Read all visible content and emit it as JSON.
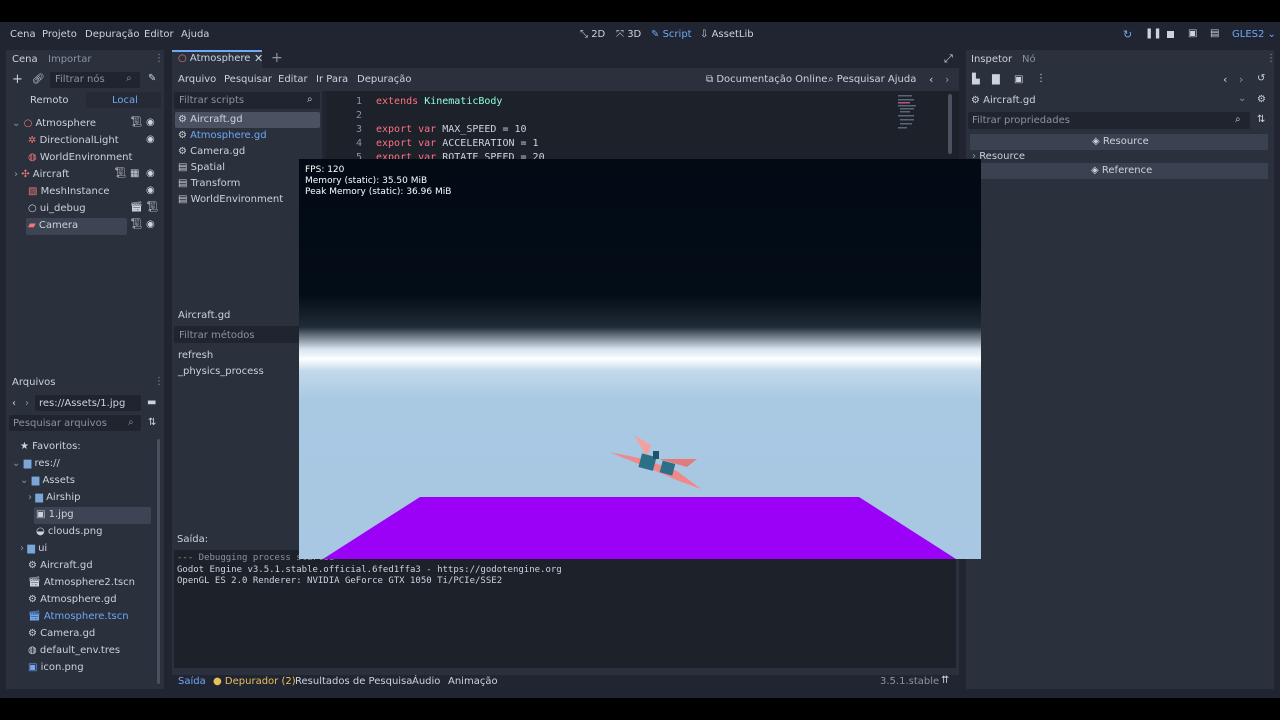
{
  "menu": [
    "Cena",
    "Projeto",
    "Depuração",
    "Editor",
    "Ajuda"
  ],
  "workspaces": [
    {
      "icon": "2d-icon",
      "label": "2D"
    },
    {
      "icon": "3d-icon",
      "label": "3D"
    },
    {
      "icon": "script-icon",
      "label": "Script"
    },
    {
      "icon": "assetlib-icon",
      "label": "AssetLib"
    }
  ],
  "renderer": "GLES2",
  "scene_dock": {
    "tabs": [
      "Cena",
      "Importar"
    ],
    "filter_placeholder": "Filtrar nós",
    "remote": "Remoto",
    "local": "Local",
    "nodes": [
      "Atmosphere",
      "DirectionalLight",
      "WorldEnvironment",
      "Aircraft",
      "MeshInstance",
      "ui_debug",
      "Camera"
    ]
  },
  "files_dock": {
    "title": "Arquivos",
    "path": "res://Assets/1.jpg",
    "search_placeholder": "Pesquisar arquivos",
    "favorites": "Favoritos:",
    "items": [
      "res://",
      "Assets",
      "Airship",
      "1.jpg",
      "clouds.png",
      "ui",
      "Aircraft.gd",
      "Atmosphere2.tscn",
      "Atmosphere.gd",
      "Atmosphere.tscn",
      "Camera.gd",
      "default_env.tres",
      "icon.png"
    ]
  },
  "editor_tabs": {
    "active": "Atmosphere"
  },
  "script_menu": [
    "Arquivo",
    "Pesquisar",
    "Editar",
    "Ir Para",
    "Depuração"
  ],
  "docs_link": "Documentação Online",
  "search_help": "Pesquisar Ajuda",
  "scripts": {
    "filter_placeholder": "Filtrar scripts",
    "items": [
      "Aircraft.gd",
      "Atmosphere.gd",
      "Camera.gd",
      "Spatial",
      "Transform",
      "WorldEnvironment"
    ],
    "current": "Aircraft.gd",
    "methods_placeholder": "Filtrar métodos",
    "methods": [
      "refresh",
      "_physics_process"
    ]
  },
  "code": [
    {
      "n": "1",
      "kw": "extends",
      "rest": "KinematicBody"
    },
    {
      "n": "2",
      "kw": "",
      "rest": ""
    },
    {
      "n": "3",
      "kw": "export var",
      "rest": "MAX_SPEED = 10"
    },
    {
      "n": "4",
      "kw": "export var",
      "rest": "ACCELERATION = 1"
    },
    {
      "n": "5",
      "kw": "export var",
      "rest": "ROTATE_SPEED = 20"
    }
  ],
  "game": {
    "fps": "FPS: 120",
    "memory": "Memory (static): 35.50 MiB",
    "peak": "Peak Memory (static): 36.96 MiB"
  },
  "output": {
    "title": "Saída:",
    "lines": [
      "--- Debugging process started ---",
      "Godot Engine v3.5.1.stable.official.6fed1ffa3 - https://godotengine.org",
      "OpenGL ES 2.0 Renderer: NVIDIA GeForce GTX 1050 Ti/PCIe/SSE2"
    ]
  },
  "bottom_tabs": [
    "Saída",
    "Depurador (2)",
    "Resultados de Pesquisa",
    "Áudio",
    "Animação"
  ],
  "version": "3.5.1.stable",
  "inspector": {
    "tabs": [
      "Inspetor",
      "Nó"
    ],
    "object": "Aircraft.gd",
    "filter_placeholder": "Filtrar propriedades",
    "resource_header": "Resource",
    "resource_section": "Resource",
    "reference_header": "Reference"
  },
  "colors": {
    "accent": "#6fa8f5",
    "floor": "#9b00f7",
    "sky": "#a9c9e3",
    "warning": "#e6c05a"
  }
}
